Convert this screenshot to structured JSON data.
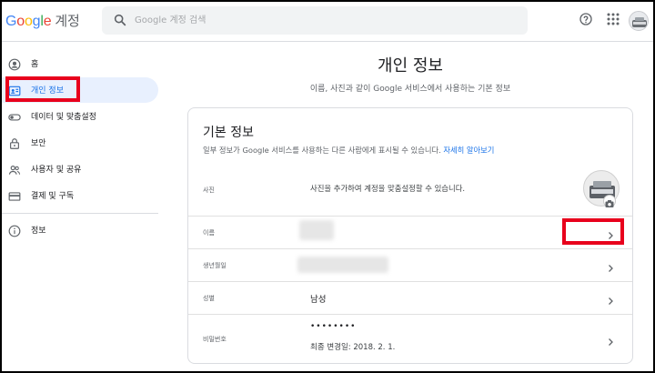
{
  "header": {
    "logo_google": [
      "G",
      "o",
      "o",
      "g",
      "l",
      "e"
    ],
    "logo_account": "계정",
    "search_placeholder": "Google 계정 검색",
    "help_icon": "help-circle-icon",
    "apps_icon": "apps-grid-icon",
    "avatar_icon": "account-avatar-icon"
  },
  "sidebar": {
    "items": [
      {
        "label": "홈",
        "icon": "account-circle-icon"
      },
      {
        "label": "개인 정보",
        "icon": "id-card-icon",
        "active": true
      },
      {
        "label": "데이터 및 맞춤설정",
        "icon": "toggle-icon"
      },
      {
        "label": "보안",
        "icon": "lock-icon"
      },
      {
        "label": "사용자 및 공유",
        "icon": "people-icon"
      },
      {
        "label": "결제 및 구독",
        "icon": "credit-card-icon"
      },
      {
        "label": "정보",
        "icon": "info-icon"
      }
    ]
  },
  "main": {
    "title": "개인 정보",
    "subtitle": "이름, 사진과 같이 Google 서비스에서 사용하는 기본 정보"
  },
  "card": {
    "title": "기본 정보",
    "desc": "일부 정보가 Google 서비스를 사용하는 다른 사람에게 표시될 수 있습니다.",
    "desc_link": "자세히 알아보기",
    "rows": [
      {
        "label": "사진",
        "value": "사진을 추가하여 계정을 맞춤설정할 수 있습니다."
      },
      {
        "label": "이름",
        "value": ""
      },
      {
        "label": "생년월일",
        "value": ""
      },
      {
        "label": "성별",
        "value": "남성"
      },
      {
        "label": "비밀번호",
        "value": "••••••••",
        "sub": "최종 변경일: 2018. 2. 1."
      }
    ]
  },
  "colors": {
    "accent": "#1a73e8",
    "active_bg": "#e8f0fe",
    "highlight": "#e8001c"
  }
}
